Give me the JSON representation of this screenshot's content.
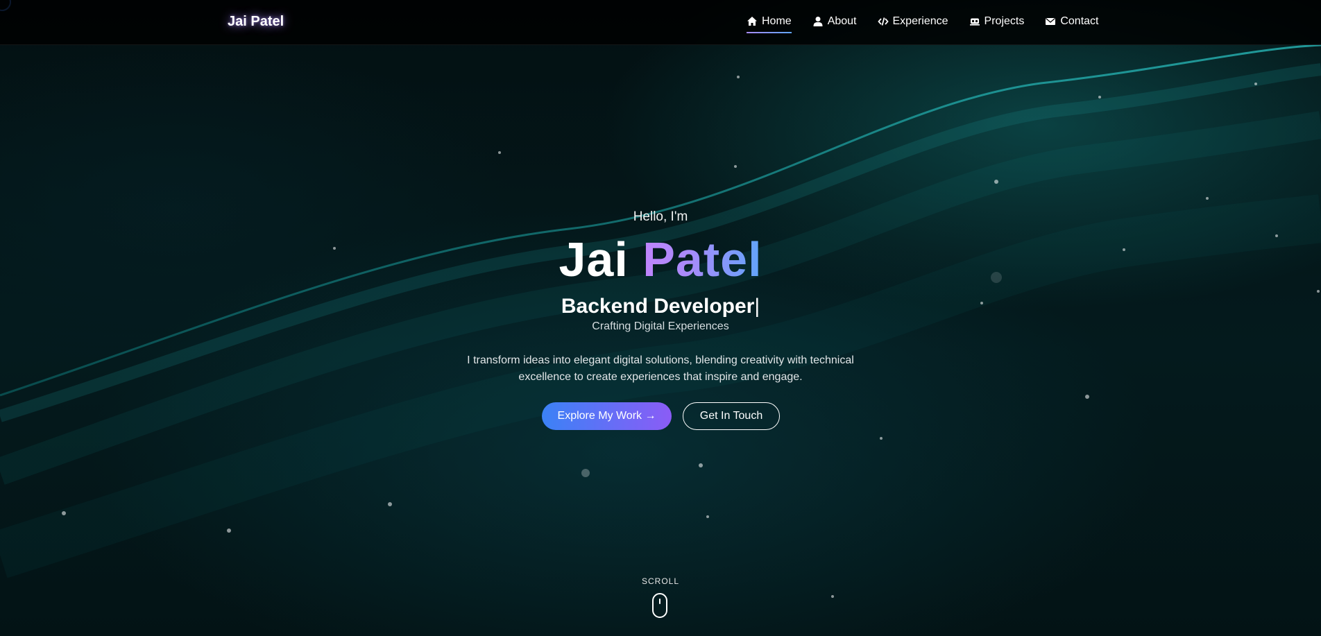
{
  "nav": {
    "brand": "Jai Patel",
    "items": [
      {
        "label": "Home",
        "icon": "home-icon",
        "active": true
      },
      {
        "label": "About",
        "icon": "user-icon",
        "active": false
      },
      {
        "label": "Experience",
        "icon": "code-icon",
        "active": false
      },
      {
        "label": "Projects",
        "icon": "laptop-icon",
        "active": false
      },
      {
        "label": "Contact",
        "icon": "envelope-icon",
        "active": false
      }
    ]
  },
  "hero": {
    "greeting": "Hello, I'm",
    "first_name": "Jai",
    "last_name": "Patel",
    "role": "Backend Developer",
    "caret": "|",
    "tagline": "Crafting Digital Experiences",
    "description": "I transform ideas into elegant digital solutions, blending creativity with technical excellence to create experiences that inspire and engage.",
    "primary_button": "Explore My Work →",
    "secondary_button": "Get In Touch"
  },
  "scroll": {
    "label": "SCROLL"
  },
  "colors": {
    "accent_purple": "#a78bfa",
    "accent_blue": "#3b82f6",
    "background": "#031012",
    "wave": "#14b8b8"
  }
}
